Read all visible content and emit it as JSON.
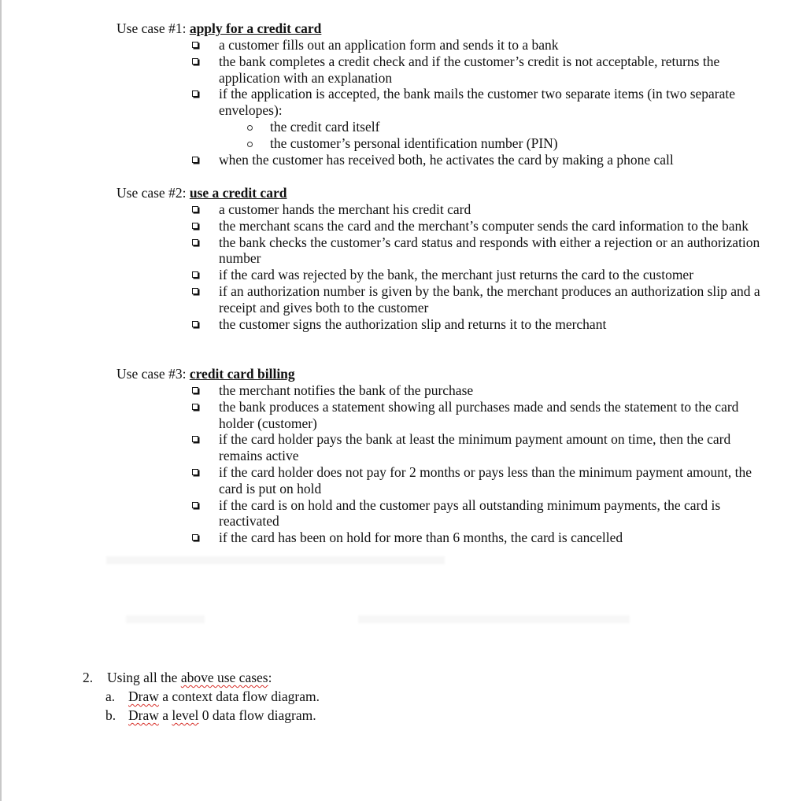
{
  "use_cases": [
    {
      "label": "Use case #1: ",
      "title": "apply for a credit card",
      "items": [
        {
          "text": " a customer fills out an application form and sends it to a bank"
        },
        {
          "text": "the bank completes a credit check and if the customer’s credit is not acceptable, returns the application with an explanation"
        },
        {
          "text": "if the application is accepted, the bank mails the customer two separate items (in two separate envelopes):",
          "subitems": [
            "the credit card itself",
            "the customer’s personal identification number (PIN)"
          ]
        },
        {
          "text": "when the customer has received both, he activates the card by making a phone call"
        }
      ]
    },
    {
      "label": "Use case #2: ",
      "title": "use a credit card",
      "items": [
        {
          "text": " a customer hands the merchant his credit card"
        },
        {
          "text": "the merchant scans the card and the merchant’s computer sends the card information to the bank"
        },
        {
          "text": "the bank checks the customer’s card status and responds with either a rejection or an authorization number"
        },
        {
          "text": "if the card was rejected by the bank, the merchant just returns the card to the customer"
        },
        {
          "text": "if an authorization number is given by the bank, the merchant produces an authorization slip and a receipt and gives both to the customer"
        },
        {
          "text": "the customer signs the authorization slip and returns it to the merchant"
        }
      ]
    },
    {
      "label": "Use case #3: ",
      "title": "credit card billing",
      "items": [
        {
          "text": "the merchant notifies the bank of the purchase"
        },
        {
          "text": "the bank produces a statement showing all purchases made and sends the statement to the card holder (customer)"
        },
        {
          "text": "if the card holder pays the bank at least the minimum payment amount on time, then the card remains active"
        },
        {
          "text": "if the card holder does not pay for 2 months or pays less than the minimum payment amount, the card is put on hold"
        },
        {
          "text": "if the card is on hold and the customer pays all outstanding minimum payments, the card is reactivated"
        },
        {
          "text": "if the card has been on hold for more than 6 months, the card is cancelled"
        }
      ]
    }
  ],
  "question2": {
    "number": "2.",
    "intro_prefix": "Using all the ",
    "intro_flagged": "above use cases",
    "intro_suffix": ":",
    "parts": [
      {
        "label": "a.",
        "flagged1": "Draw",
        "text1": " a context data flow diagram.",
        "flagged2": "",
        "text2": ""
      },
      {
        "label": "b.",
        "flagged1": "Draw",
        "text1": " a ",
        "flagged2": "level",
        "text2": " 0 data flow diagram."
      }
    ]
  },
  "colors": {
    "spellcheck_underline": "#d8312b",
    "page_edge": "#c8c8c8"
  }
}
